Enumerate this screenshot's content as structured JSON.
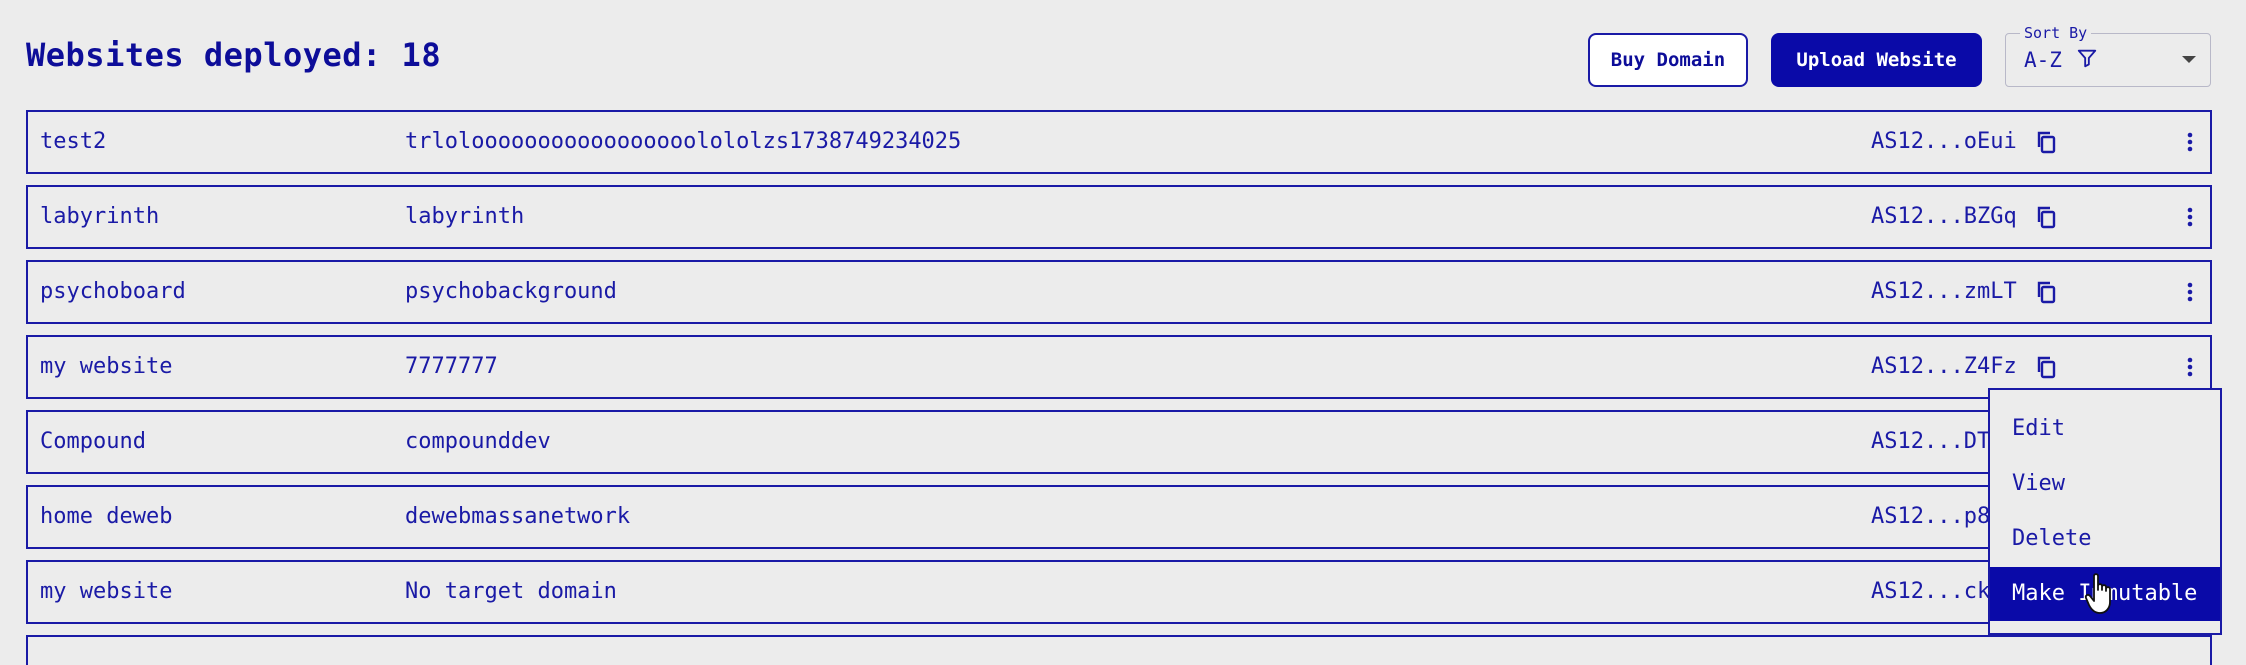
{
  "header": {
    "title": "Websites deployed: 18",
    "buy_domain_label": "Buy Domain",
    "upload_label": "Upload Website",
    "sort": {
      "label": "Sort By",
      "value": "A-Z"
    }
  },
  "websites": [
    {
      "name": "test2",
      "domain": "trlolooooooooooooooooolololzs1738749234025",
      "address": "AS12...oEui"
    },
    {
      "name": "labyrinth",
      "domain": "labyrinth",
      "address": "AS12...BZGq"
    },
    {
      "name": "psychoboard",
      "domain": "psychobackground",
      "address": "AS12...zmLT"
    },
    {
      "name": "my website",
      "domain": "7777777",
      "address": "AS12...Z4Fz"
    },
    {
      "name": "Compound",
      "domain": "compounddev",
      "address": "AS12...DT"
    },
    {
      "name": "home deweb",
      "domain": "dewebmassanetwork",
      "address": "AS12...p8"
    },
    {
      "name": "my website",
      "domain": "No target domain",
      "address": "AS12...ck"
    }
  ],
  "context_menu": {
    "items": [
      "Edit",
      "View",
      "Delete",
      "Make Immutable"
    ],
    "active_index": 3
  },
  "colors": {
    "accent": "#0a0aa8",
    "text": "#1a1aa6",
    "background": "#ececec"
  },
  "icons": {
    "copy": "copy-icon",
    "more": "kebab-menu-icon",
    "filter": "filter-icon",
    "dropdown": "chevron-down-icon"
  }
}
